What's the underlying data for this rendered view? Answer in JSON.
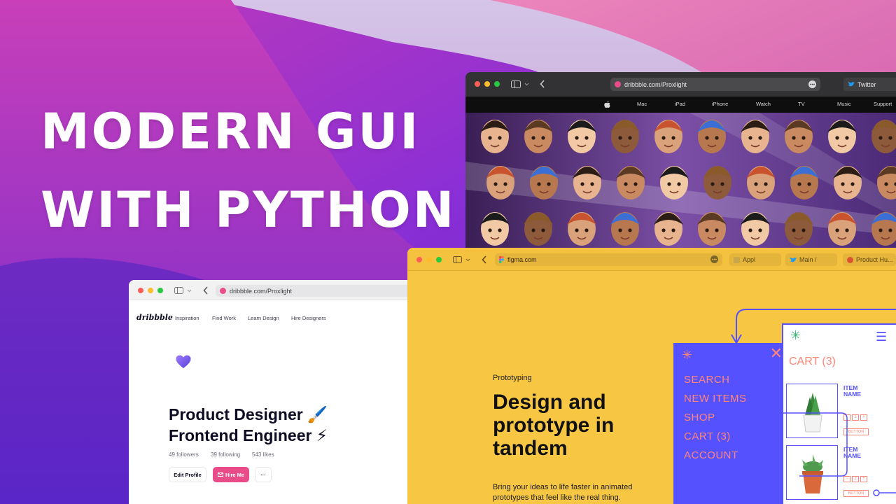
{
  "headline": {
    "line1": "MODERN GUI",
    "line2": "WITH PYTHON"
  },
  "apple_window": {
    "url": "dribbble.com/Proxlight",
    "tab_label": "Twitter",
    "nav_items": [
      "Mac",
      "iPad",
      "iPhone",
      "Watch",
      "TV",
      "Music",
      "Support"
    ]
  },
  "dribbble_window": {
    "url": "dribbble.com/Proxlight",
    "logo": "dribbble",
    "nav_items": [
      "Inspiration",
      "Find Work",
      "Learn Design",
      "Hire Designers"
    ],
    "title_line1": "Product Designer 🖌️",
    "title_line2": "Frontend Engineer ⚡",
    "stats": {
      "followers": "49 followers",
      "following": "39 following",
      "likes": "543 likes"
    },
    "buttons": {
      "edit": "Edit Profile",
      "hire": "Hire Me",
      "more": "···"
    }
  },
  "figma_window": {
    "url": "figma.com",
    "tabs": [
      "Appl",
      "Main /",
      "Product Hu..."
    ],
    "eyebrow": "Prototyping",
    "title": [
      "Design and",
      "prototype in",
      "tandem"
    ],
    "body": [
      "Bring your ideas to life faster in animated",
      "prototypes that feel like the real thing."
    ],
    "menu_items": [
      "SEARCH",
      "NEW ITEMS",
      "SHOP",
      "CART (3)",
      "ACCOUNT"
    ],
    "cart_title": "CART (3)",
    "item_name": "ITEM NAME",
    "qty": [
      "-",
      "2",
      "+"
    ],
    "button_label": "BUTTON"
  },
  "colors": {
    "figma_yellow": "#f7c744",
    "figma_blue": "#5551ff",
    "figma_coral": "#ff8577",
    "dribbble_pink": "#ea4c89"
  },
  "icons": [
    "apple-logo-icon",
    "sidebar-icon",
    "back-chevron-icon",
    "heart-icon",
    "sparkle-icon",
    "close-icon",
    "hamburger-icon",
    "plant-pot-icon"
  ]
}
